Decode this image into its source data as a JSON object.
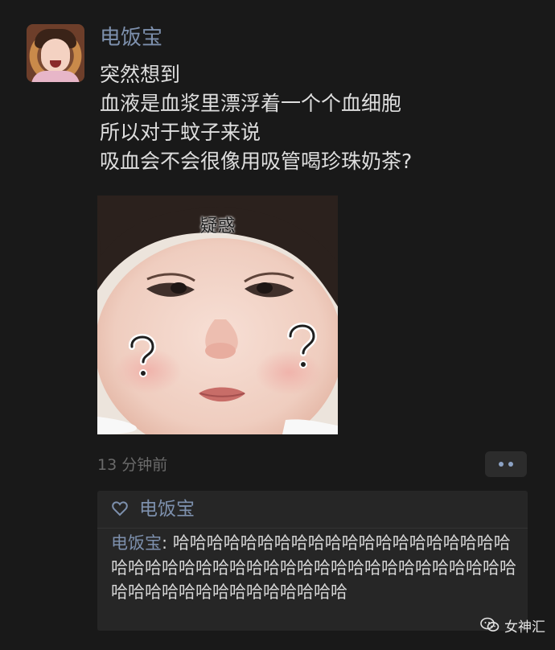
{
  "post": {
    "author": "电饭宝",
    "lines": [
      "突然想到",
      "血液是血浆里漂浮着一个个血细胞",
      "所以对于蚊子来说",
      "吸血会不会很像用吸管喝珍珠奶茶?"
    ],
    "image_caption": "疑惑",
    "time": "13 分钟前"
  },
  "likes": {
    "names": "电饭宝"
  },
  "comment": {
    "author": "电饭宝",
    "separator": ": ",
    "text": "哈哈哈哈哈哈哈哈哈哈哈哈哈哈哈哈哈哈哈哈哈哈哈哈哈哈哈哈哈哈哈哈哈哈哈哈哈哈哈哈哈哈哈哈哈哈哈哈哈哈哈哈哈哈哈哈哈哈"
  },
  "watermark": {
    "text": "女神汇"
  },
  "colors": {
    "background": "#191919",
    "name_blue": "#7d90ad",
    "body_text": "#dedede",
    "muted": "#6a6a6a",
    "panel": "#262626"
  },
  "icons": {
    "like": "heart-outline-icon",
    "more": "more-dots-icon",
    "watermark": "wechat-official-account-icon"
  }
}
